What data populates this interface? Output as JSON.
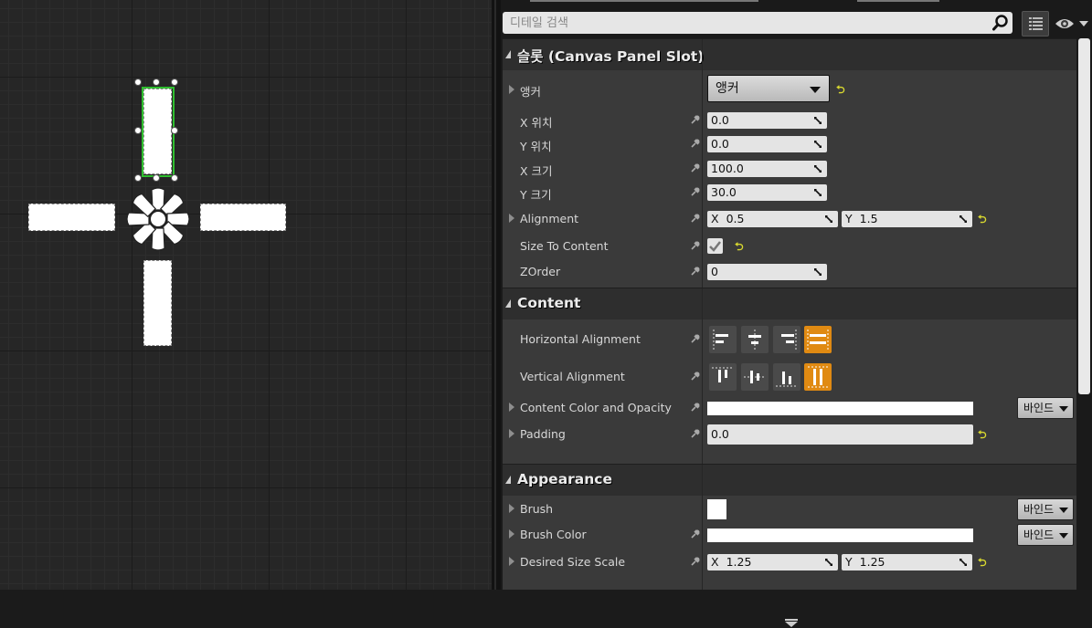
{
  "search": {
    "placeholder": "디테일 검색"
  },
  "categories": {
    "slot": "슬롯 (Canvas Panel Slot)",
    "content": "Content",
    "appearance": "Appearance"
  },
  "slot": {
    "anchor_label": "앵커",
    "anchor_value": "앵커",
    "pos_x_label": "X 위치",
    "pos_x_value": "0.0",
    "pos_y_label": "Y 위치",
    "pos_y_value": "0.0",
    "size_x_label": "X 크기",
    "size_x_value": "100.0",
    "size_y_label": "Y 크기",
    "size_y_value": "30.0",
    "alignment_label": "Alignment",
    "alignment_x_axis": "X",
    "alignment_x": "0.5",
    "alignment_y_axis": "Y",
    "alignment_y": "1.5",
    "size_to_content_label": "Size To Content",
    "size_to_content_checked": true,
    "zorder_label": "ZOrder",
    "zorder_value": "0"
  },
  "content": {
    "h_align_label": "Horizontal Alignment",
    "h_align_active": "fill",
    "v_align_label": "Vertical Alignment",
    "v_align_active": "fill",
    "color_label": "Content Color and Opacity",
    "color_value": "#ffffff",
    "padding_label": "Padding",
    "padding_value": "0.0"
  },
  "appearance": {
    "brush_label": "Brush",
    "brush_color_label": "Brush Color",
    "brush_color_value": "#ffffff",
    "desired_size_label": "Desired Size Scale",
    "desired_x_axis": "X",
    "desired_x": "1.25",
    "desired_y_axis": "Y",
    "desired_y": "1.25"
  },
  "bind_label": "바인드",
  "colors": {
    "selection": "#2fbf2f",
    "active_button": "#e08a12",
    "reset_arrow": "#d9d92f"
  }
}
